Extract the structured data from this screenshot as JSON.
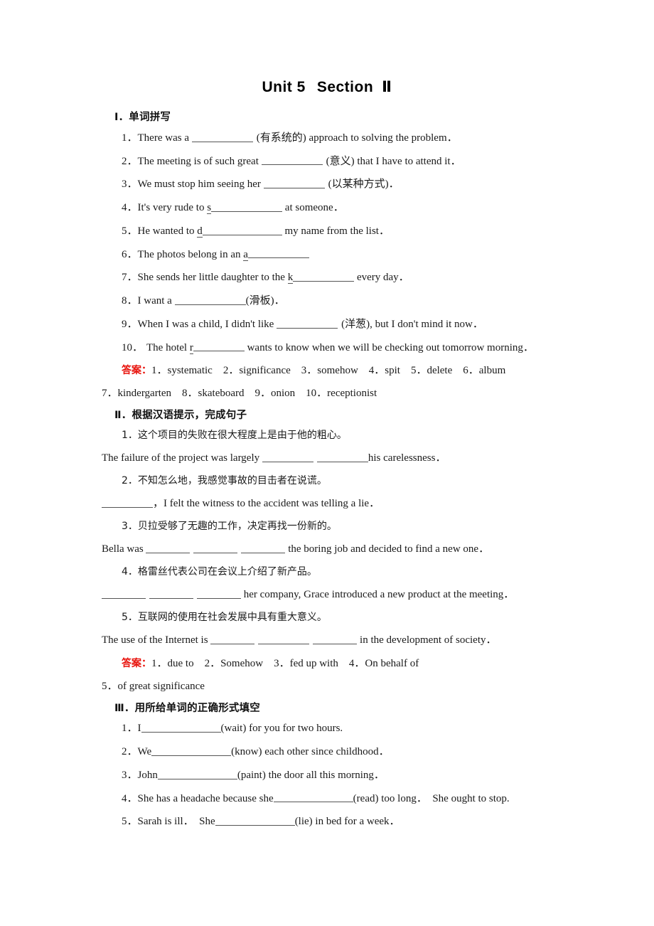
{
  "title": {
    "unit": "Unit 5",
    "section": "Section",
    "numeral": "Ⅱ"
  },
  "sections": [
    {
      "heading": "Ⅰ．单词拼写",
      "items": [
        {
          "num": "1．",
          "pre": "There was a ",
          "hint": "(有系统的)",
          "post": " approach to solving the problem．"
        },
        {
          "num": "2．",
          "pre": "The meeting is of such great ",
          "hint": "(意义)",
          "post": " that I have to attend it．"
        },
        {
          "num": "3．",
          "pre": "We must stop him seeing her ",
          "hint": "(以某种方式)",
          "post": "．"
        },
        {
          "num": "4．",
          "pre": "It's very rude to ",
          "lead": "s",
          "post": " at someone．"
        },
        {
          "num": "5．",
          "pre": "He wanted to ",
          "lead": "d",
          "post": " my name from the list．"
        },
        {
          "num": "6．",
          "pre": "The photos belong in an ",
          "lead": "a",
          "post": ""
        },
        {
          "num": "7．",
          "pre": "She sends her little daughter to the ",
          "lead": "k",
          "post": " every day．"
        },
        {
          "num": "8．",
          "pre": "I want a ",
          "hint": "(滑板)",
          "post": "．"
        },
        {
          "num": "9．",
          "pre": "When I was a child, I didn't like ",
          "hint": "(洋葱)",
          "post": ", but I don't mind it now．"
        },
        {
          "num": "10．",
          "pre": "The hotel ",
          "lead": "r",
          "post": " wants to know when we will be checking out tomorrow morning．"
        }
      ],
      "answer": {
        "label": "答案：",
        "line1": "1．systematic　2．significance　3．somehow　4．spit　5．delete　6．album",
        "line2": "7．kindergarten　8．skateboard　9．onion　10．receptionist"
      }
    },
    {
      "heading": "Ⅱ．根据汉语提示，完成句子",
      "items": [
        {
          "num": "1．",
          "chinese": "这个项目的失败在很大程度上是由于他的粗心。",
          "en_pre": "The failure of the project was largely ",
          "blanks": 2,
          "en_post": "his carelessness．"
        },
        {
          "num": "2．",
          "chinese": "不知怎么地，我感觉事故的目击者在说谎。",
          "en_pre": "",
          "blanks": 1,
          "en_post": "，I felt the witness to the accident was telling a lie．"
        },
        {
          "num": "3．",
          "chinese": "贝拉受够了无趣的工作，决定再找一份新的。",
          "en_pre": "Bella was ",
          "blanks": 3,
          "en_post": " the boring job and decided to find a new one．"
        },
        {
          "num": "4．",
          "chinese": "格雷丝代表公司在会议上介绍了新产品。",
          "en_pre": "",
          "blanks": 3,
          "en_post": " her company, Grace introduced a new product at the meeting．"
        },
        {
          "num": "5．",
          "chinese": "互联网的使用在社会发展中具有重大意义。",
          "en_pre": "The use of the Internet is ",
          "blanks": 3,
          "en_post": " in the development of society．"
        }
      ],
      "answer": {
        "label": "答案：",
        "line1": "1．due to　2．Somehow　3．fed up with　4．On behalf of",
        "line2": "5．of great significance"
      }
    },
    {
      "heading": "Ⅲ．用所给单词的正确形式填空",
      "items": [
        {
          "num": "1．",
          "pre": "I",
          "hint": "(wait)",
          "post": " for you for two hours."
        },
        {
          "num": "2．",
          "pre": "We",
          "hint": "(know)",
          "post": " each other since childhood．"
        },
        {
          "num": "3．",
          "pre": "John",
          "hint": "(paint)",
          "post": " the door all this morning．"
        },
        {
          "num": "4．",
          "pre": "She has a headache because she",
          "hint": "(read)",
          "post": " too long．　She ought to stop."
        },
        {
          "num": "5．",
          "pre": "Sarah is ill．　She",
          "hint": "(lie)",
          "post": " in bed for a week．"
        }
      ]
    }
  ],
  "colors": {
    "answer_red": "#e8120b",
    "text": "#1a1a1a",
    "rule": "#555555"
  }
}
